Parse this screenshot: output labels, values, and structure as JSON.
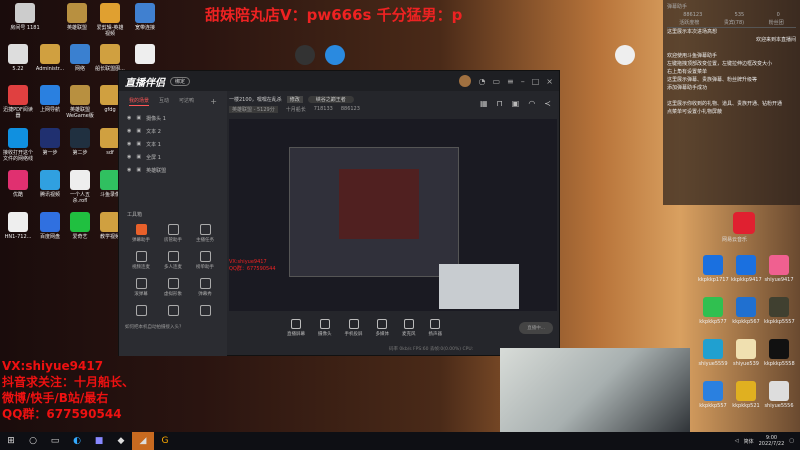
{
  "banner": "甜妹陪丸店V：pw666s  千分猛男：p",
  "desktop_left": [
    {
      "label": "房间号 1181",
      "color": "#ccc"
    },
    {
      "label": "英雄联盟",
      "color": "#b89040"
    },
    {
      "label": "爱剪辑-英雄视频",
      "color": "#e0a030"
    },
    {
      "label": "宽带连接",
      "color": "#4080d0"
    },
    {
      "label": "5.22",
      "color": "#ddd"
    },
    {
      "label": "Administr...",
      "color": "#d0a040"
    },
    {
      "label": "网络",
      "color": "#3a80d0"
    },
    {
      "label": "船长联盟图...",
      "color": "#d0a040"
    },
    {
      "label": "",
      "color": "#eee"
    },
    {
      "label": "迅捷PDF阅读器",
      "color": "#e04040"
    },
    {
      "label": "上网导航",
      "color": "#2a80e0"
    },
    {
      "label": "英雄联盟 WeGame版",
      "color": "#b89040"
    },
    {
      "label": "gfdg",
      "color": "#d0a040"
    },
    {
      "label": "接收打开这个文件的网络线",
      "color": "#1090e0"
    },
    {
      "label": "第一步",
      "color": "#203070"
    },
    {
      "label": "第二步",
      "color": "#203040"
    },
    {
      "label": "sdf",
      "color": "#d0a040"
    },
    {
      "label": "优酷",
      "color": "#e03070"
    },
    {
      "label": "腾讯视频",
      "color": "#30a0e0"
    },
    {
      "label": "一个人五杀.rofl",
      "color": "#eee"
    },
    {
      "label": "斗鱼录像",
      "color": "#30c060"
    },
    {
      "label": "HN1-712...",
      "color": "#eee"
    },
    {
      "label": "百度网盘",
      "color": "#3070e0"
    },
    {
      "label": "爱奇艺",
      "color": "#20c040"
    },
    {
      "label": "教学视频",
      "color": "#d0a040"
    }
  ],
  "desktop_top": [
    {
      "label": "",
      "color": "#333"
    },
    {
      "label": "",
      "color": "#2a8ae0"
    },
    {
      "label": "",
      "color": "#eee"
    }
  ],
  "app": {
    "logo": "直播伴侣",
    "version": "绑定",
    "tabs": [
      "我的场景",
      "互动",
      "可达鸭"
    ],
    "sources": [
      "摄像头 1",
      "文本 2",
      "文本 1",
      "全屏 1",
      "英雄联盟"
    ],
    "toolbox_title": "工具箱",
    "tools": [
      "弹幕助手",
      "房管助手",
      "主播任务",
      "视频连麦",
      "多人连麦",
      "榜单助手",
      "滚弹幕",
      "虚拟形象",
      "弹幕秀",
      "",
      "",
      ""
    ],
    "tip": "如何把本机自动拍摄接入头？",
    "room_title": "一楼2100，嘿嘿在乱杀",
    "room_tag": "修改",
    "room_category": "峡谷之巅王者",
    "stats": [
      "英雄联盟 - 5129分",
      "十月船长",
      "718133",
      "886123"
    ],
    "bottom_buttons": [
      "直播屏幕",
      "摄像头",
      "手机投屏",
      "多媒体",
      "麦克风",
      "扬声器"
    ],
    "start_label": "直播中...",
    "status": "码率 0kb/s   FPS:60   丢帧:0(0.00%)   CPU:"
  },
  "chat": {
    "title": "弹幕助手",
    "stats": [
      "886123",
      "535",
      "0"
    ],
    "tabs": [
      "活跃度榜",
      "贵宾(78)",
      "粉丝团"
    ],
    "lines": [
      "这里展示本次进场高想",
      "欢迎来到本直播间",
      "欢迎使用斗鱼弹幕助手",
      "左键拖拽顶部改变位置，左键拉伸边框改变大小",
      "右上角有设置菜单",
      "这里展示弹幕、贵族弹幕、粉丝牌升级等",
      "添加弹幕助手成功",
      "这里展示你收到的礼物、道具、贵族开通、钻粉开通",
      "点菜单可设置小礼物屏蔽"
    ]
  },
  "netease_label": "网易云音乐",
  "desktop_right": [
    {
      "label": "kkpkkp1717",
      "color": "#1a70e0"
    },
    {
      "label": "kkpkkp9417",
      "color": "#1a70e0"
    },
    {
      "label": "shiyue9417",
      "color": "#f06090"
    },
    {
      "label": "kkpkkp577",
      "color": "#30c050"
    },
    {
      "label": "kkpkkp567",
      "color": "#2070d0"
    },
    {
      "label": "kkpkkp5557",
      "color": "#404030"
    },
    {
      "label": "shiyue5559",
      "color": "#20a0d0"
    },
    {
      "label": "shiyue539",
      "color": "#f0e0b0"
    },
    {
      "label": "kkpkkp5558",
      "color": "#111"
    },
    {
      "label": "kkpkkp557",
      "color": "#2a80e0"
    },
    {
      "label": "kkpkkp521",
      "color": "#e0b020"
    },
    {
      "label": "shiyue5556",
      "color": "#ddd"
    }
  ],
  "overlay": [
    "VX:shiyue9417",
    "抖音求关注：十月船长、",
    "微博/快手/B站/最右",
    "QQ群：677590544"
  ],
  "taskbar": {
    "ime": "简体",
    "time": "9:00",
    "date": "2022/7/22"
  }
}
